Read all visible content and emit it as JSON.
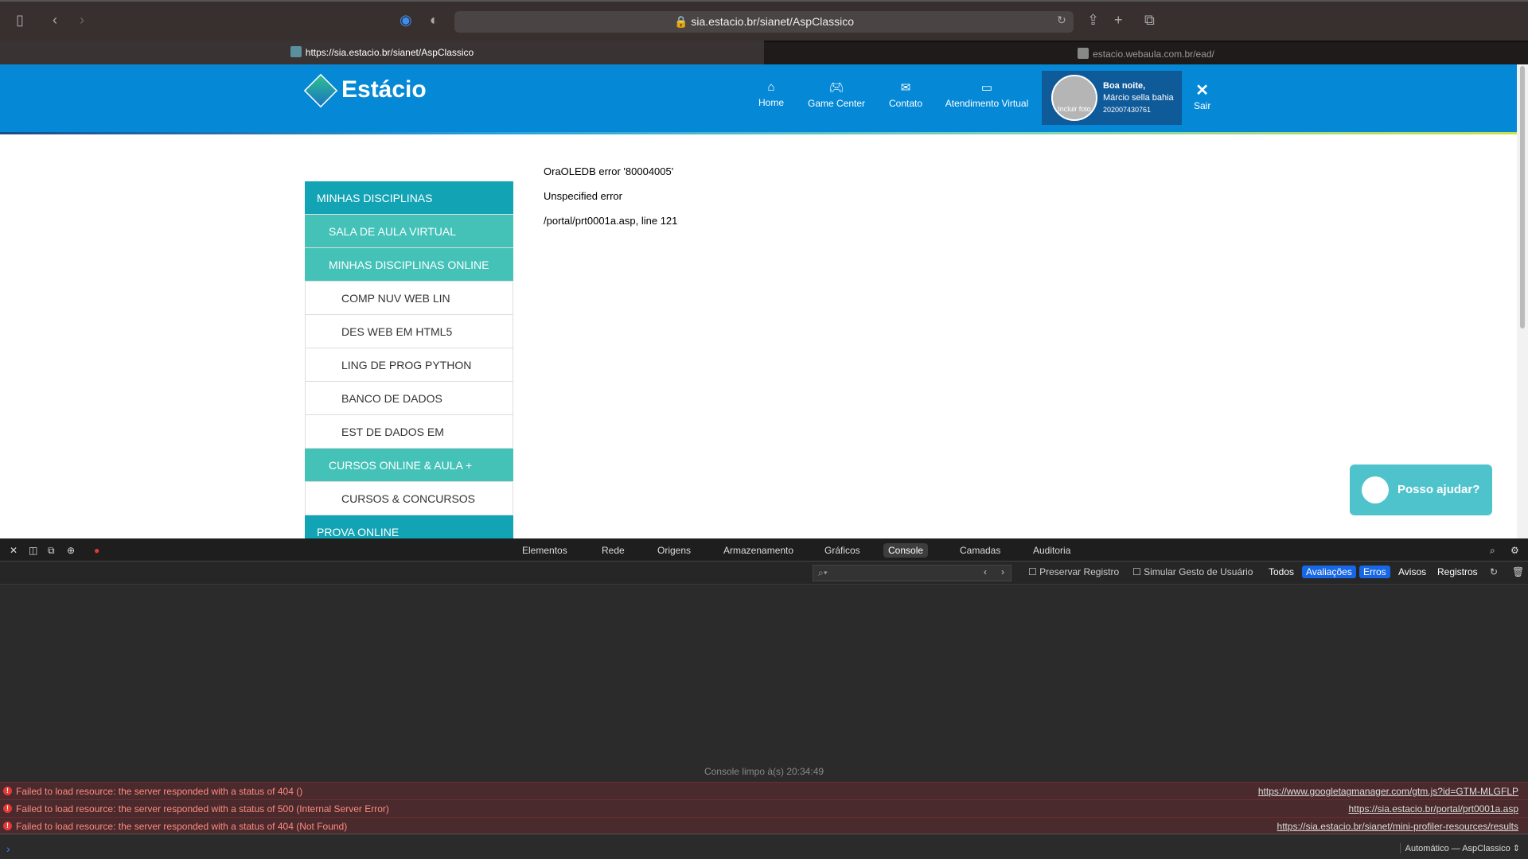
{
  "browser": {
    "url": "sia.estacio.br/sianet/AspClassico",
    "tabs": [
      {
        "label": "https://sia.estacio.br/sianet/AspClassico"
      },
      {
        "label": "estacio.webaula.com.br/ead/"
      }
    ]
  },
  "header": {
    "logo": "Estácio",
    "nav": [
      {
        "label": "Home",
        "icon": "home-icon"
      },
      {
        "label": "Game Center",
        "icon": "gamepad-icon"
      },
      {
        "label": "Contato",
        "icon": "mail-icon"
      },
      {
        "label": "Atendimento Virtual",
        "icon": "chat-icon"
      }
    ],
    "user": {
      "greeting": "Boa noite,",
      "name": "Márcio sella bahia",
      "id": "202007430761",
      "photo_label": "Incluir foto"
    },
    "logout": "Sair"
  },
  "sidebar": {
    "items": [
      {
        "label": "MINHAS DISCIPLINAS"
      },
      {
        "label": "SALA DE AULA VIRTUAL"
      },
      {
        "label": "MINHAS DISCIPLINAS ONLINE"
      },
      {
        "label": "COMP NUV WEB LIN"
      },
      {
        "label": "DES WEB EM HTML5"
      },
      {
        "label": "LING DE PROG PYTHON"
      },
      {
        "label": "BANCO DE DADOS"
      },
      {
        "label": "EST DE DADOS EM"
      },
      {
        "label": "CURSOS ONLINE & AULA +"
      },
      {
        "label": "CURSOS & CONCURSOS"
      },
      {
        "label": "PROVA ONLINE"
      }
    ]
  },
  "error": {
    "line1": "OraOLEDB error '80004005'",
    "line2": "Unspecified error",
    "line3": "/portal/prt0001a.asp, line 121"
  },
  "chat": {
    "label": "Posso ajudar?"
  },
  "devtools": {
    "tabs": [
      "Elementos",
      "Rede",
      "Origens",
      "Armazenamento",
      "Gráficos",
      "Console",
      "Camadas",
      "Auditoria"
    ],
    "active_tab": "Console",
    "filters": {
      "preserve": "Preservar Registro",
      "simulate": "Simular Gesto de Usuário",
      "all": "Todos",
      "evaluations": "Avaliações",
      "errors": "Erros",
      "warnings": "Avisos",
      "logs": "Registros"
    },
    "cleared": "Console limpo à(s) 20:34:49",
    "messages": [
      {
        "text": "Failed to load resource: the server responded with a status of 404 ()",
        "source": "https://www.googletagmanager.com/gtm.js?id=GTM-MLGFLP"
      },
      {
        "text": "Failed to load resource: the server responded with a status of 500 (Internal Server Error)",
        "source": "https://sia.estacio.br/portal/prt0001a.asp"
      },
      {
        "text": "Failed to load resource: the server responded with a status of 404 (Not Found)",
        "source": "https://sia.estacio.br/sianet/mini-profiler-resources/results"
      }
    ],
    "context": "Automático — AspClassico"
  }
}
